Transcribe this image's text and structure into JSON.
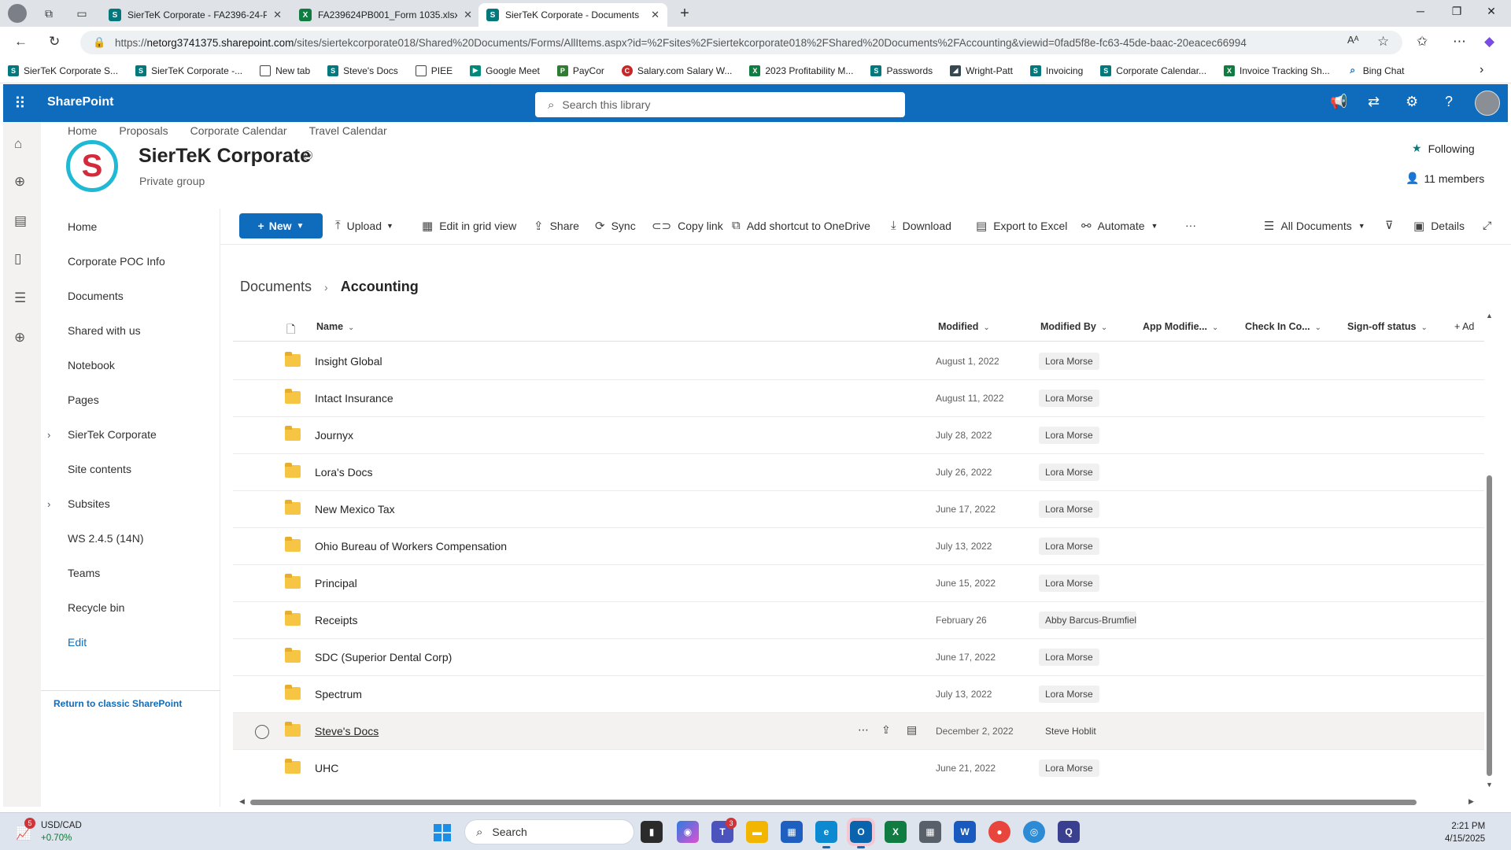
{
  "browser": {
    "tabs": [
      {
        "label": "SierTeK Corporate - FA2396-24-P",
        "icon": "sharepoint-icon",
        "active": false
      },
      {
        "label": "FA239624PB001_Form 1035.xlsx",
        "icon": "excel-icon",
        "active": false
      },
      {
        "label": "SierTeK Corporate - Documents",
        "icon": "sharepoint-icon",
        "active": true
      }
    ],
    "url_prefix": "https://",
    "url_host": "netorg3741375.sharepoint.com",
    "url_path": "/sites/siertekcorporate018/Shared%20Documents/Forms/AllItems.aspx?id=%2Fsites%2Fsiertekcorporate018%2FShared%20Documents%2FAccounting&viewid=0fad5f8e-fc63-45de-baac-20eacec66994",
    "bookmarks": [
      {
        "label": "SierTeK Corporate S...",
        "icon": "sharepoint-icon"
      },
      {
        "label": "SierTeK Corporate -...",
        "icon": "sharepoint-icon"
      },
      {
        "label": "New tab",
        "icon": "tab-icon"
      },
      {
        "label": "Steve's Docs",
        "icon": "sharepoint-icon"
      },
      {
        "label": "PIEE",
        "icon": "folder-icon"
      },
      {
        "label": "Google Meet",
        "icon": "meet-icon"
      },
      {
        "label": "PayCor",
        "icon": "paycor-icon"
      },
      {
        "label": "Salary.com Salary W...",
        "icon": "salary-icon"
      },
      {
        "label": "2023 Profitability M...",
        "icon": "excel-icon"
      },
      {
        "label": "Passwords",
        "icon": "sharepoint-icon"
      },
      {
        "label": "Wright-Patt",
        "icon": "image-icon"
      },
      {
        "label": "Invoicing",
        "icon": "sharepoint-icon"
      },
      {
        "label": "Corporate Calendar...",
        "icon": "sharepoint-icon"
      },
      {
        "label": "Invoice Tracking Sh...",
        "icon": "excel-icon"
      },
      {
        "label": "Bing Chat",
        "icon": "search-icon"
      }
    ]
  },
  "suite": {
    "app_name": "SharePoint",
    "search_placeholder": "Search this library"
  },
  "site": {
    "top_nav": [
      "Home",
      "Proposals",
      "Corporate Calendar",
      "Travel Calendar"
    ],
    "logo_letter": "S",
    "title": "SierTeK Corporate",
    "privacy": "Private group",
    "following": "Following",
    "members": "11 members"
  },
  "left_nav": {
    "items": [
      "Home",
      "Corporate POC Info",
      "Documents",
      "Shared with us",
      "Notebook",
      "Pages",
      "SierTek Corporate",
      "Site contents",
      "Subsites",
      "WS 2.4.5 (14N)",
      "Teams",
      "Recycle bin",
      "Edit"
    ],
    "return_classic": "Return to classic SharePoint"
  },
  "command_bar": {
    "new": "New",
    "upload": "Upload",
    "edit_grid": "Edit in grid view",
    "share": "Share",
    "sync": "Sync",
    "copy_link": "Copy link",
    "add_shortcut": "Add shortcut to OneDrive",
    "download": "Download",
    "export_excel": "Export to Excel",
    "automate": "Automate",
    "more": "···",
    "view": "All Documents",
    "details": "Details"
  },
  "breadcrumb": {
    "root": "Documents",
    "current": "Accounting"
  },
  "columns": {
    "name": "Name",
    "modified": "Modified",
    "modified_by": "Modified By",
    "app_modified": "App Modifie...",
    "check_in": "Check In Co...",
    "signoff": "Sign-off status",
    "add": "+ Ad"
  },
  "rows": [
    {
      "name": "Insight Global",
      "modified": "August 1, 2022",
      "by": "Lora Morse"
    },
    {
      "name": "Intact Insurance",
      "modified": "August 11, 2022",
      "by": "Lora Morse"
    },
    {
      "name": "Journyx",
      "modified": "July 28, 2022",
      "by": "Lora Morse"
    },
    {
      "name": "Lora's Docs",
      "modified": "July 26, 2022",
      "by": "Lora Morse"
    },
    {
      "name": "New Mexico Tax",
      "modified": "June 17, 2022",
      "by": "Lora Morse"
    },
    {
      "name": "Ohio Bureau of Workers Compensation",
      "modified": "July 13, 2022",
      "by": "Lora Morse"
    },
    {
      "name": "Principal",
      "modified": "June 15, 2022",
      "by": "Lora Morse"
    },
    {
      "name": "Receipts",
      "modified": "February 26",
      "by": "Abby Barcus-Brumfiel"
    },
    {
      "name": "SDC (Superior Dental Corp)",
      "modified": "June 17, 2022",
      "by": "Lora Morse"
    },
    {
      "name": "Spectrum",
      "modified": "July 13, 2022",
      "by": "Lora Morse"
    },
    {
      "name": "Steve's Docs",
      "modified": "December 2, 2022",
      "by": "Steve Hoblit",
      "selected": true
    },
    {
      "name": "UHC",
      "modified": "June 21, 2022",
      "by": "Lora Morse"
    }
  ],
  "taskbar": {
    "ticker": "USD/CAD",
    "change": "+0.70%",
    "weather_badge": "5",
    "search": "Search",
    "teams_badge": "3",
    "time": "2:21 PM",
    "date": "4/15/2025"
  }
}
